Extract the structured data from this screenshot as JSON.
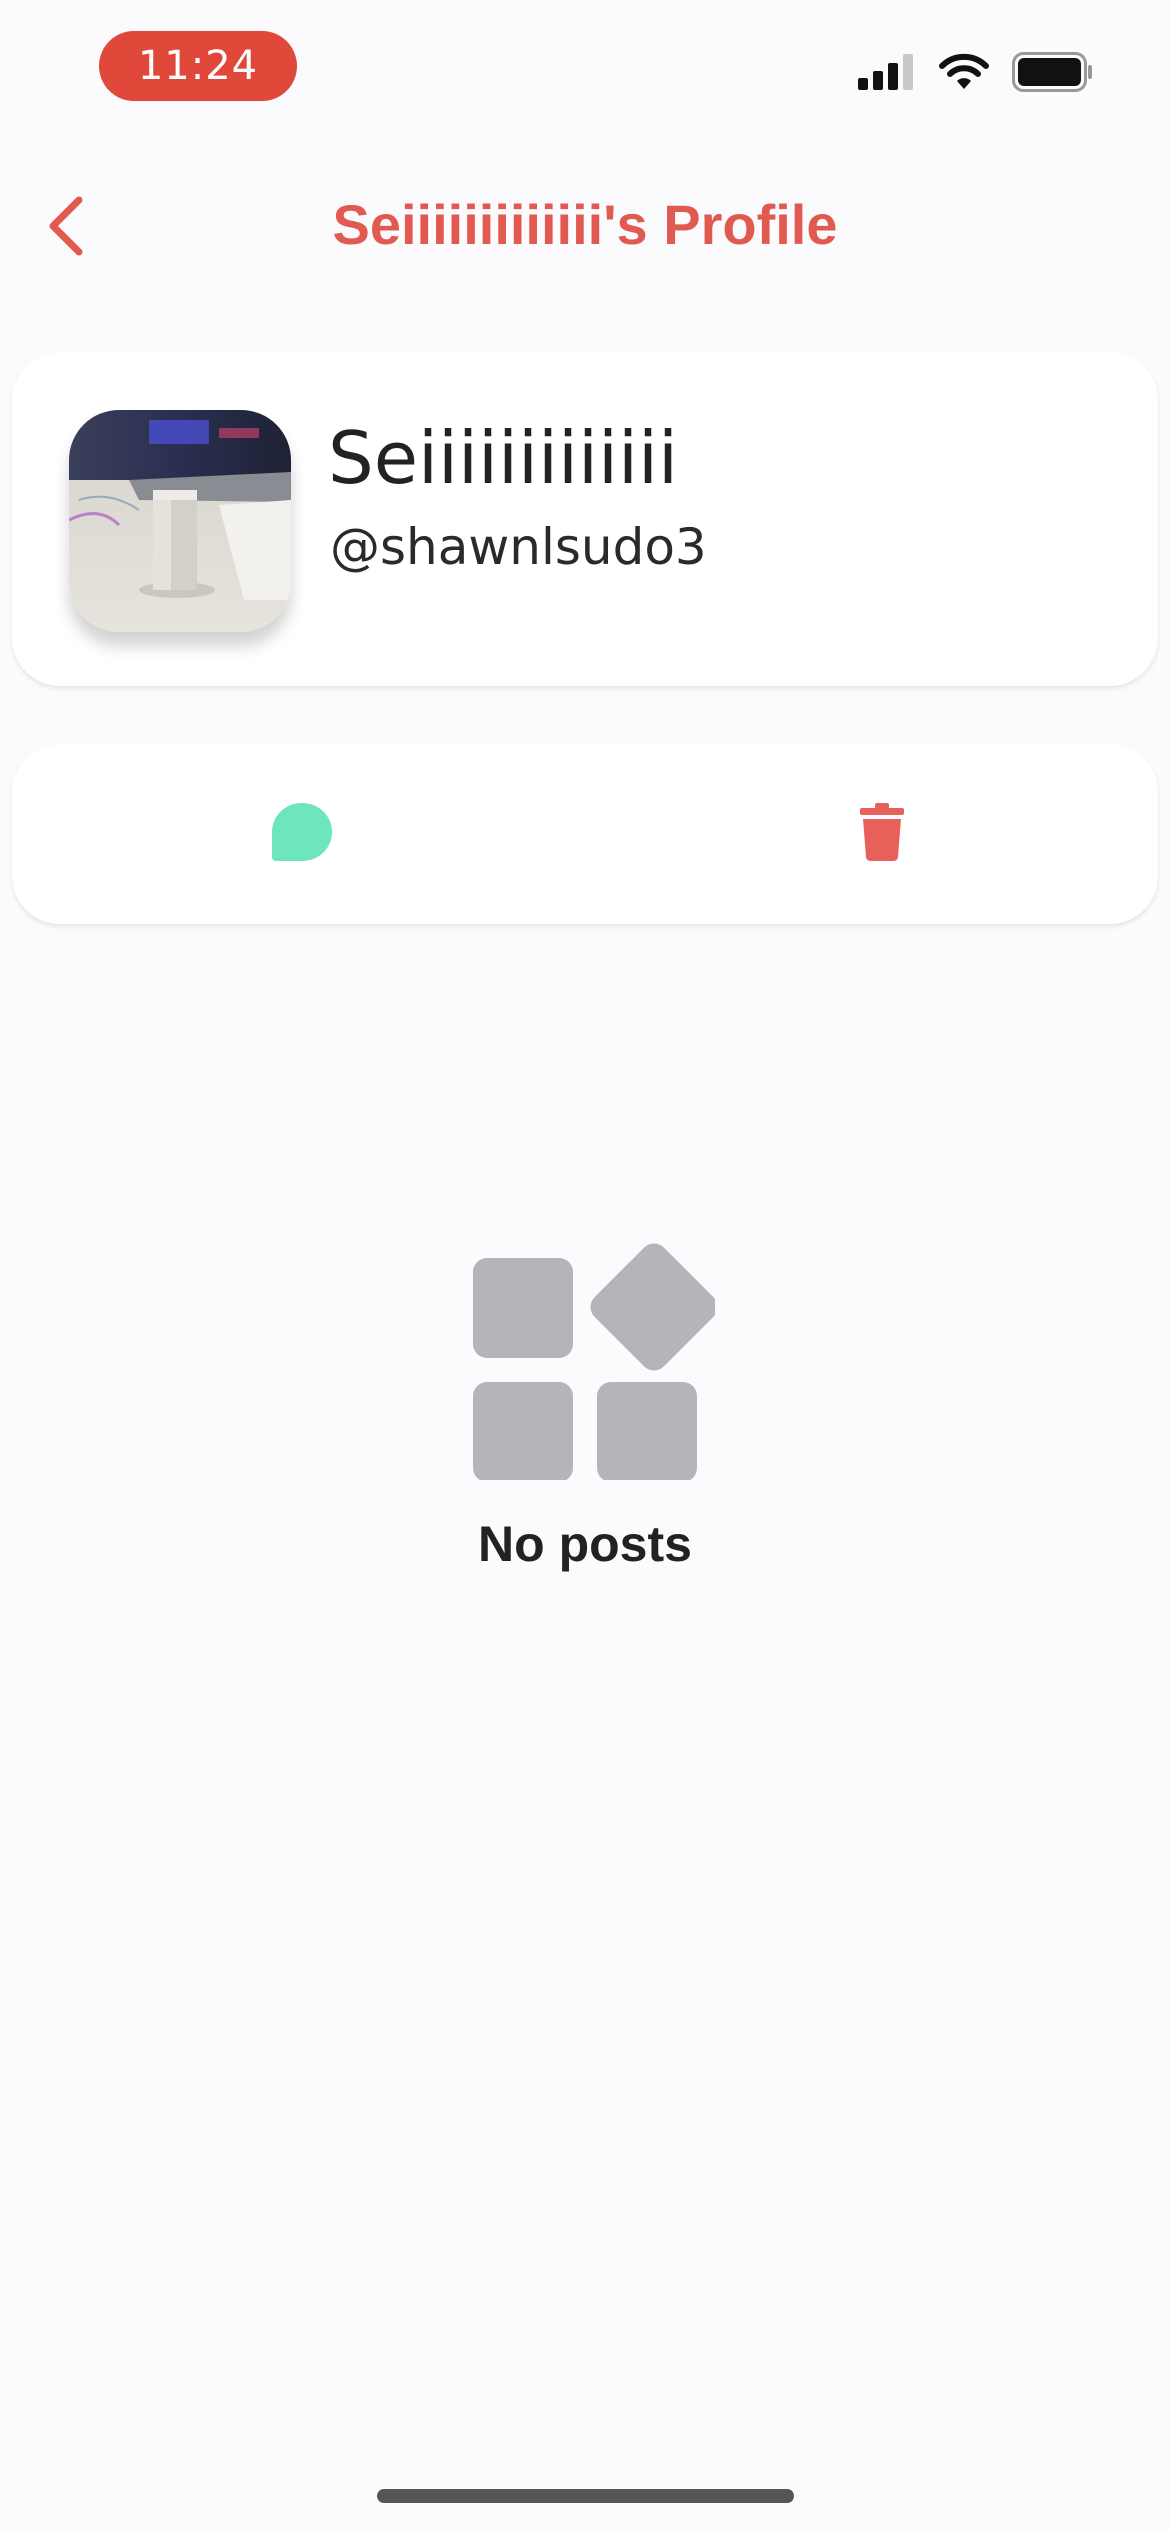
{
  "status_bar": {
    "time": "11:24",
    "icons": [
      "cellular-signal-icon",
      "wifi-icon",
      "battery-icon"
    ]
  },
  "header": {
    "title": "Seiiiiiiiiiiiii's Profile",
    "back_icon": "chevron-left-icon"
  },
  "profile": {
    "display_name": "Seiiiiiiiiiiiii",
    "username": "@shawnlsudo3"
  },
  "actions": {
    "message_icon": "chat-bubble-icon",
    "delete_icon": "trash-icon"
  },
  "empty_state": {
    "icon": "apps-grid-icon",
    "text": "No posts"
  },
  "colors": {
    "accent": "#e05a52",
    "time_pill": "#e0483a",
    "message": "#6ee6bb",
    "delete": "#e8605a",
    "empty_icon": "#b5b4b8",
    "background": "#fbfafd"
  }
}
